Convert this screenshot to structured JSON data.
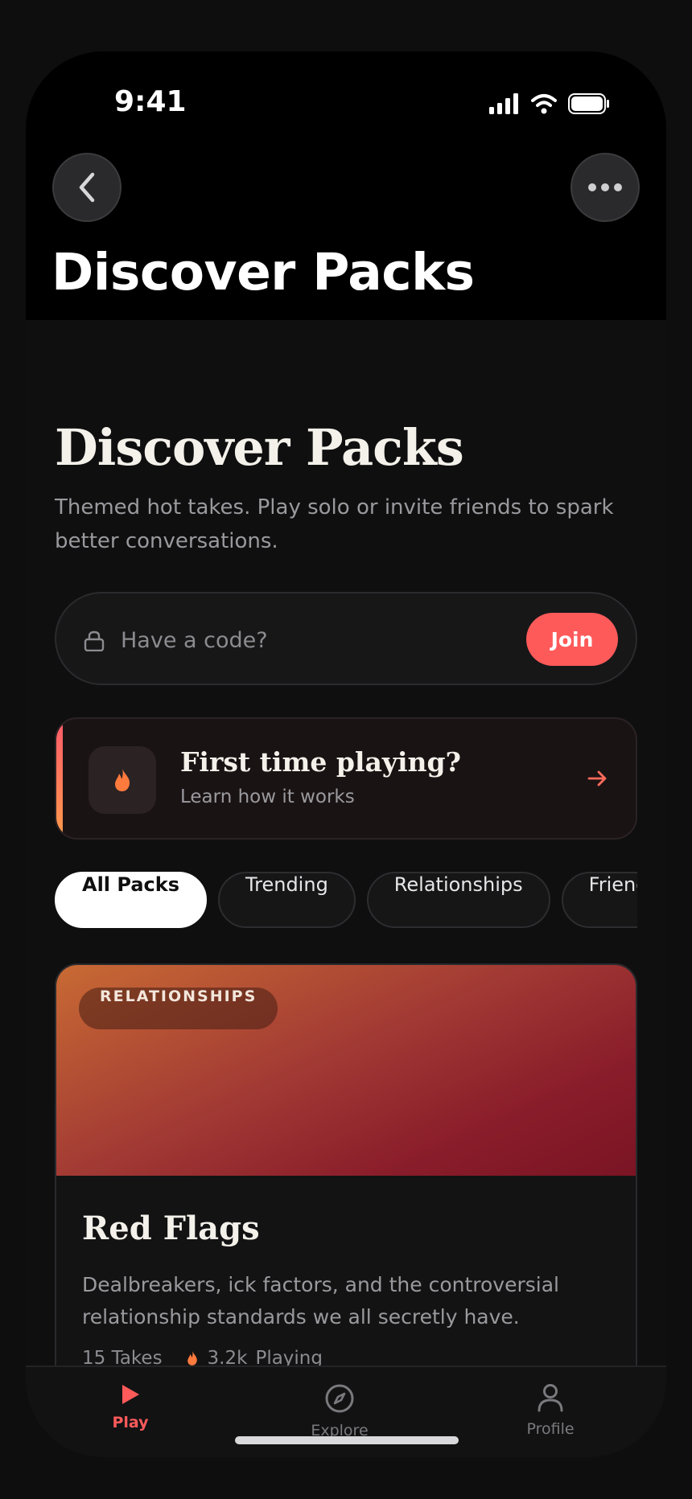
{
  "status_bar": {
    "time": "9:41"
  },
  "nav": {
    "title": "Discover Packs"
  },
  "hero": {
    "title": "Discover Packs",
    "subtitle": "Themed hot takes. Play solo or invite friends to spark better conversations."
  },
  "code_entry": {
    "placeholder": "Have a code?",
    "value": "",
    "join_label": "Join"
  },
  "first_time": {
    "title": "First time playing?",
    "subtitle": "Learn how it works"
  },
  "filters": {
    "chips": [
      {
        "label": "All Packs",
        "active": true
      },
      {
        "label": "Trending",
        "active": false
      },
      {
        "label": "Relationships",
        "active": false
      },
      {
        "label": "Friendships",
        "active": false
      }
    ]
  },
  "pack": {
    "tag": "RELATIONSHIPS",
    "title": "Red Flags",
    "description": "Dealbreakers, ick factors, and the controversial relationship standards we all secretly have.",
    "takes": "15 Takes",
    "playing_count": "3.2k",
    "playing_label": "Playing"
  },
  "tabbar": {
    "items": [
      {
        "label": "Play",
        "icon": "play-icon",
        "active": true
      },
      {
        "label": "Explore",
        "icon": "compass-icon",
        "active": false
      },
      {
        "label": "Profile",
        "icon": "person-icon",
        "active": false
      }
    ]
  },
  "colors": {
    "accent": "#ff5a5a",
    "background": "#0f0f10",
    "surface": "#171718"
  }
}
